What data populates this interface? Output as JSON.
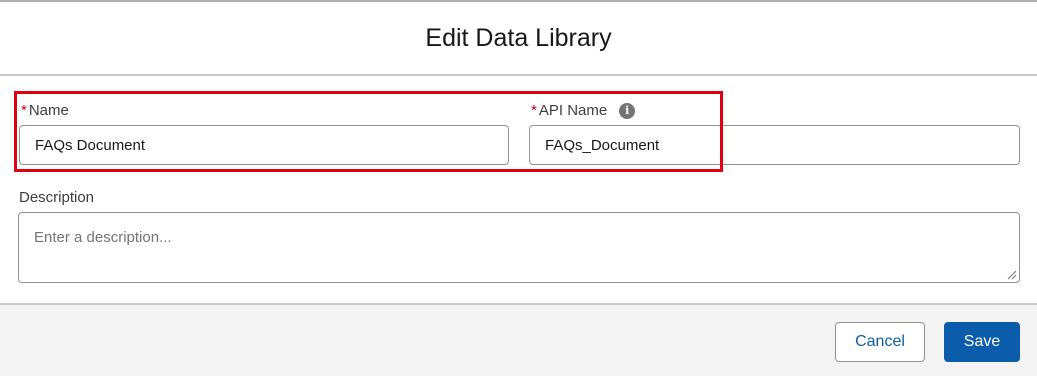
{
  "modal": {
    "title": "Edit Data Library"
  },
  "form": {
    "name": {
      "required_marker": "*",
      "label": "Name",
      "value": "FAQs Document"
    },
    "api_name": {
      "required_marker": "*",
      "label": "API Name",
      "info_icon": "info-icon",
      "info_glyph": "i",
      "value": "FAQs_Document"
    },
    "description": {
      "label": "Description",
      "placeholder": "Enter a description...",
      "value": ""
    }
  },
  "footer": {
    "cancel_label": "Cancel",
    "save_label": "Save"
  },
  "colors": {
    "brand": "#0b5cab",
    "required": "#ba0517",
    "highlight": "#e0000f"
  }
}
